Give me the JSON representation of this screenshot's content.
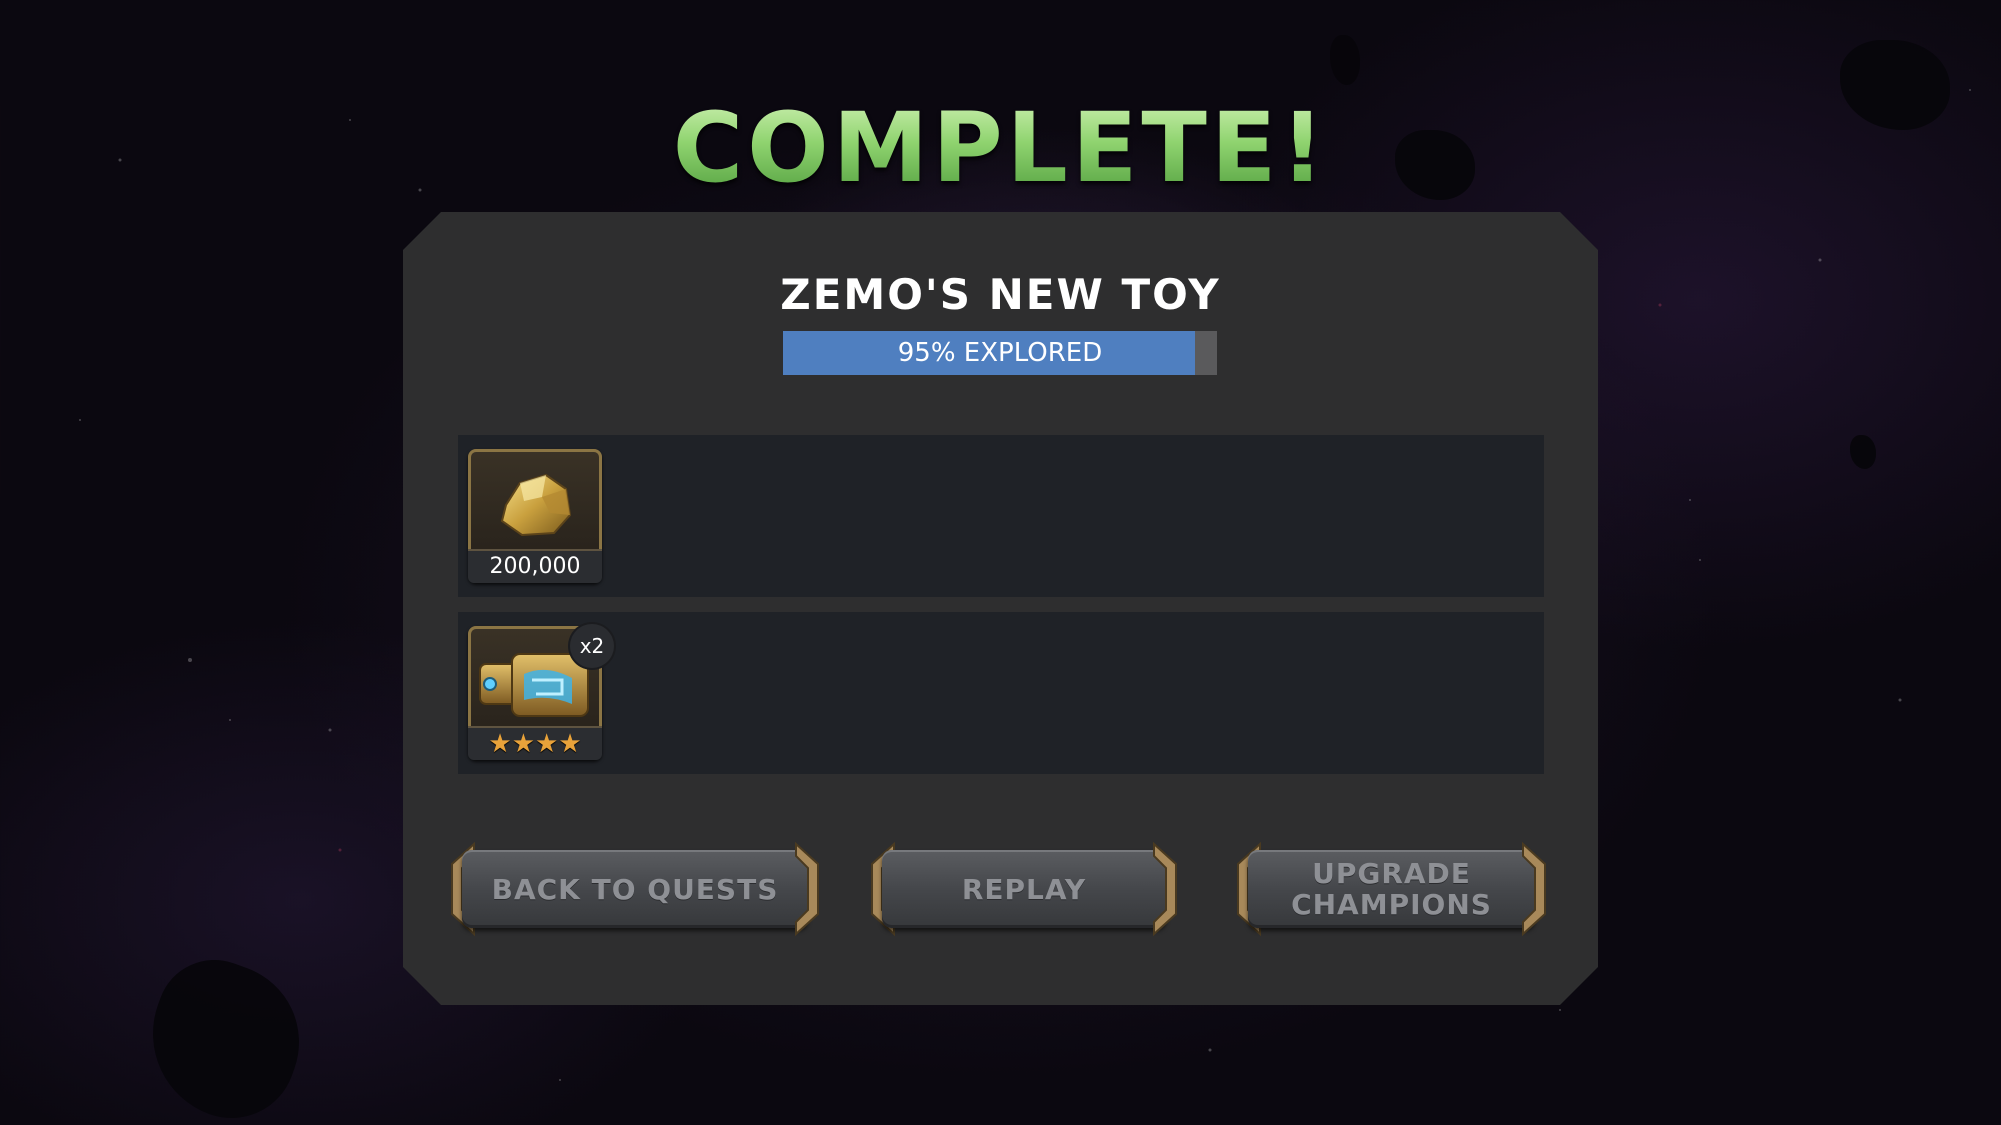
{
  "screen": {
    "title": "COMPLETE!"
  },
  "quest": {
    "name": "ZEMO'S NEW TOY",
    "progress_percent": 95,
    "progress_label": "95% EXPLORED"
  },
  "rewards": [
    {
      "icon": "gold-nugget-icon",
      "amount": "200,000"
    },
    {
      "icon": "iso8-crystal-crate-icon",
      "quantity": "x2",
      "stars": 4
    }
  ],
  "buttons": {
    "back_to_quests": "BACK TO QUESTS",
    "replay": "REPLAY",
    "upgrade_champions": "UPGRADE CHAMPIONS"
  },
  "colors": {
    "title_green": "#8fd36f",
    "progress_fill": "#4f7fc0",
    "panel": "#2e2e2f",
    "star": "#e8a23a",
    "bracket_gold": "#a8895a"
  }
}
